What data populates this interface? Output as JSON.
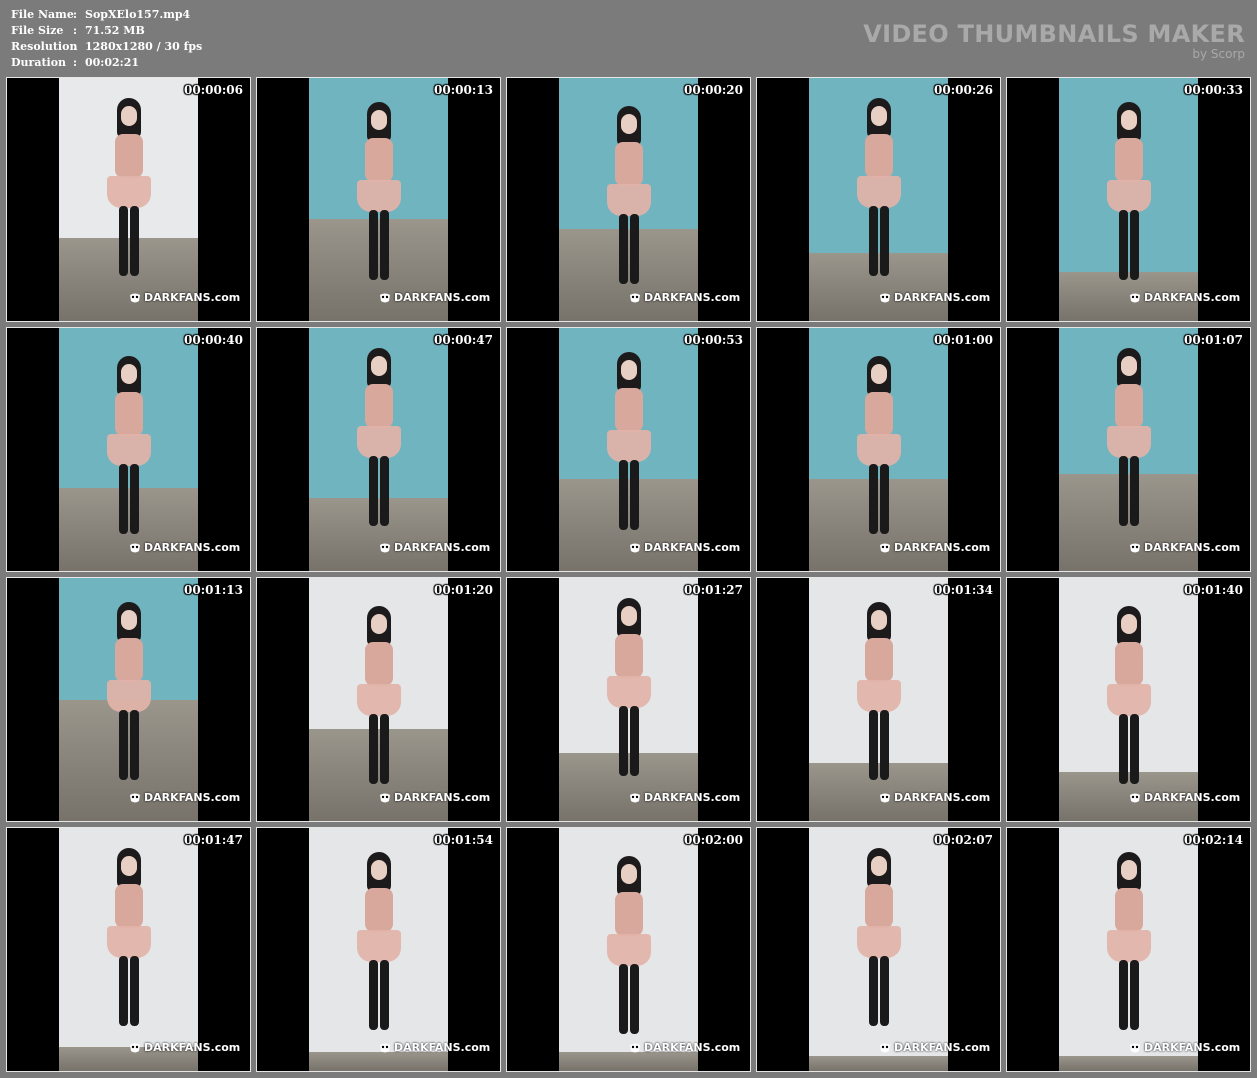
{
  "info": {
    "rows": [
      {
        "key": "File Name",
        "sep": ":",
        "value": "SopXElo157.mp4"
      },
      {
        "key": "File Size",
        "sep": ":",
        "value": "71.52 MB"
      },
      {
        "key": "Resolution",
        "sep": ":",
        "value": "1280x1280 / 30 fps"
      },
      {
        "key": "Duration",
        "sep": ":",
        "value": "00:02:21"
      }
    ]
  },
  "brand": {
    "title": "VIDEO THUMBNAILS MAKER",
    "subtitle": "by Scorp"
  },
  "watermark": "DARKFANS.com",
  "thumbnails": [
    {
      "time": "00:00:06",
      "wall": "#e7e9eb",
      "wallh": 66
    },
    {
      "time": "00:00:13",
      "wall": "#6fb4bf",
      "wallh": 58
    },
    {
      "time": "00:00:20",
      "wall": "#6fb4bf",
      "wallh": 62
    },
    {
      "time": "00:00:26",
      "wall": "#6fb4bf",
      "wallh": 72
    },
    {
      "time": "00:00:33",
      "wall": "#6fb4bf",
      "wallh": 80
    },
    {
      "time": "00:00:40",
      "wall": "#6fb4bf",
      "wallh": 66
    },
    {
      "time": "00:00:47",
      "wall": "#6fb4bf",
      "wallh": 70
    },
    {
      "time": "00:00:53",
      "wall": "#6fb4bf",
      "wallh": 62
    },
    {
      "time": "00:01:00",
      "wall": "#6fb4bf",
      "wallh": 62
    },
    {
      "time": "00:01:07",
      "wall": "#6fb4bf",
      "wallh": 60
    },
    {
      "time": "00:01:13",
      "wall": "#6fb4bf",
      "wallh": 50
    },
    {
      "time": "00:01:20",
      "wall": "#e4e6e8",
      "wallh": 62
    },
    {
      "time": "00:01:27",
      "wall": "#e4e6e8",
      "wallh": 72
    },
    {
      "time": "00:01:34",
      "wall": "#e4e6e8",
      "wallh": 76
    },
    {
      "time": "00:01:40",
      "wall": "#e4e6e8",
      "wallh": 80
    },
    {
      "time": "00:01:47",
      "wall": "#e4e6e8",
      "wallh": 90
    },
    {
      "time": "00:01:54",
      "wall": "#e4e6e8",
      "wallh": 92
    },
    {
      "time": "00:02:00",
      "wall": "#e4e6e8",
      "wallh": 92
    },
    {
      "time": "00:02:07",
      "wall": "#e4e6e8",
      "wallh": 94
    },
    {
      "time": "00:02:14",
      "wall": "#e4e6e8",
      "wallh": 94
    }
  ]
}
